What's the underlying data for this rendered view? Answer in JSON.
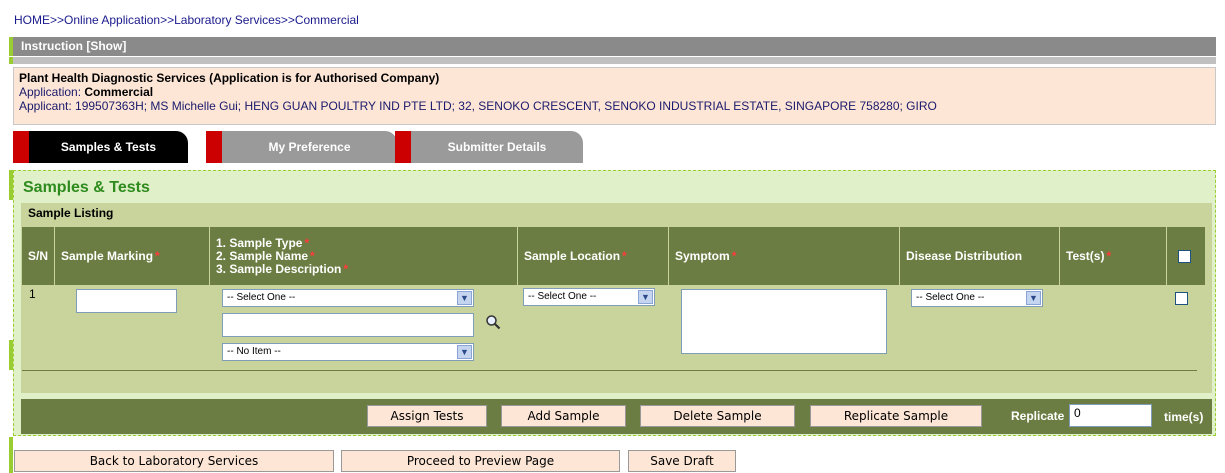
{
  "breadcrumb": "HOME>>Online Application>>Laboratory Services>>Commercial",
  "instruction": {
    "label": "Instruction [Show]"
  },
  "info": {
    "title": "Plant Health Diagnostic Services (Application is for Authorised Company)",
    "application_label": "Application: ",
    "application_value": "Commercial",
    "applicant": "Applicant: 199507363H; MS Michelle Gui; HENG GUAN POULTRY IND PTE LTD; 32, SENOKO CRESCENT, SENOKO INDUSTRIAL ESTATE, SINGAPORE 758280; GIRO"
  },
  "tabs": [
    {
      "label": "Samples & Tests",
      "active": true
    },
    {
      "label": "My Preference",
      "active": false
    },
    {
      "label": "Submitter Details",
      "active": false
    }
  ],
  "main": {
    "title": "Samples & Tests",
    "listing_label": "Sample Listing",
    "headers": {
      "sn": "S/N",
      "marking": "Sample Marking",
      "type_line1": "1. Sample Type",
      "type_line2": "2. Sample Name",
      "type_line3": "3. Sample Description",
      "location": "Sample Location",
      "symptom": "Symptom",
      "distribution": "Disease Distribution",
      "tests": "Test(s)"
    },
    "row": {
      "sn": "1",
      "marking_value": "",
      "sample_type": "-- Select One --",
      "sample_name_value": "",
      "sample_description": "-- No Item --",
      "location": "-- Select One --",
      "symptom_value": "",
      "distribution": "-- Select One --"
    }
  },
  "buttons": {
    "assign": "Assign Tests",
    "add": "Add Sample",
    "delete": "Delete Sample",
    "replicate": "Replicate Sample",
    "replicate_label": "Replicate",
    "replicate_value": "0",
    "times_label": "time(s)"
  },
  "footer": {
    "back": "Back to Laboratory Services",
    "preview": "Proceed to Preview Page",
    "save": "Save Draft"
  },
  "colors": {
    "tab_active": "#000000",
    "tab_inactive": "#9a9a9a",
    "tab_marker": "#cc0000",
    "title_green": "#2e8b1e",
    "header_bar": "#6b7d42",
    "button_bg": "#fde6d6"
  }
}
